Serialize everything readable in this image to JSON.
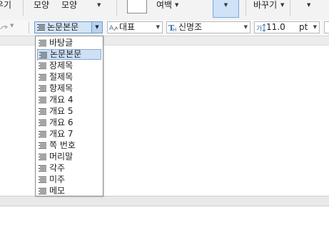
{
  "ribbon": {
    "left_cut_label": "우기",
    "shape_label_1": "모양",
    "shape_label_2": "모양",
    "margin_label": "여백",
    "replace_label": "바꾸기"
  },
  "toolbar": {
    "style_value": "논문본문",
    "paragraph_value": "대표",
    "font_value": "신명조",
    "size_value": "11.0",
    "size_unit": "pt"
  },
  "style_list": {
    "items": [
      "바탕글",
      "논문본문",
      "장제목",
      "절제목",
      "항제목",
      "개요 4",
      "개요 5",
      "개요 6",
      "개요 7",
      "쪽 번호",
      "머리말",
      "각주",
      "미주",
      "메모"
    ],
    "selected_index": 1
  },
  "colors": {
    "selection_bg": "#cde0f6",
    "active_button_bg": "#cfe2f7",
    "accent_border": "#6b9bd1"
  }
}
